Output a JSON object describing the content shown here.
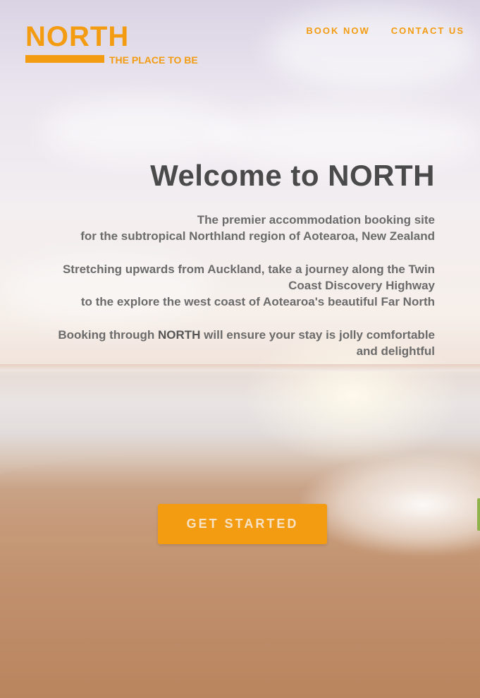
{
  "brand": {
    "name": "NORTH",
    "tagline": "THE PLACE TO BE",
    "accent_color": "#f39c12"
  },
  "nav": {
    "items": [
      {
        "label": "BOOK NOW"
      },
      {
        "label": "CONTACT US"
      }
    ]
  },
  "hero": {
    "heading": "Welcome to NORTH",
    "para1_line1": "The premier accommodation booking site",
    "para1_line2": "for the subtropical Northland region of Aotearoa, New Zealand",
    "para2_line1": "Stretching upwards from Auckland, take a journey along the Twin",
    "para2_line2": "Coast Discovery Highway",
    "para2_line3": "to the explore the west coast of Aotearoa's beautiful Far North",
    "para3_prefix": "Booking through ",
    "para3_brand": "NORTH",
    "para3_suffix_line1": " will ensure your stay is jolly comfortable",
    "para3_suffix_line2": "and delightful",
    "cta_label": "GET STARTED",
    "background_image": "beach-sunset"
  }
}
